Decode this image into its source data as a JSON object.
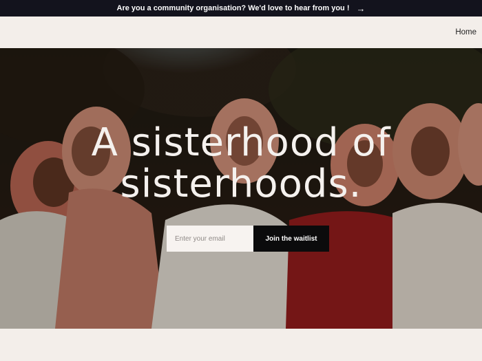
{
  "announcement": {
    "text": "Are you a community organisation? We'd love to hear from you !",
    "arrow": "→"
  },
  "nav": {
    "home_label": "Home"
  },
  "hero": {
    "headline_line1": "A sisterhood of",
    "headline_line2": "sisterhoods.",
    "email_placeholder": "Enter your email",
    "cta_label": "Join the waitlist"
  },
  "colors": {
    "topbar_bg": "#13131d",
    "nav_bg": "#f3eeea",
    "cta_bg": "#0b0b0c",
    "hijab_tone": "#c47a64",
    "dress_red": "#8e1c1c"
  },
  "icons": {
    "announcement_arrow": "arrow-right-icon"
  }
}
